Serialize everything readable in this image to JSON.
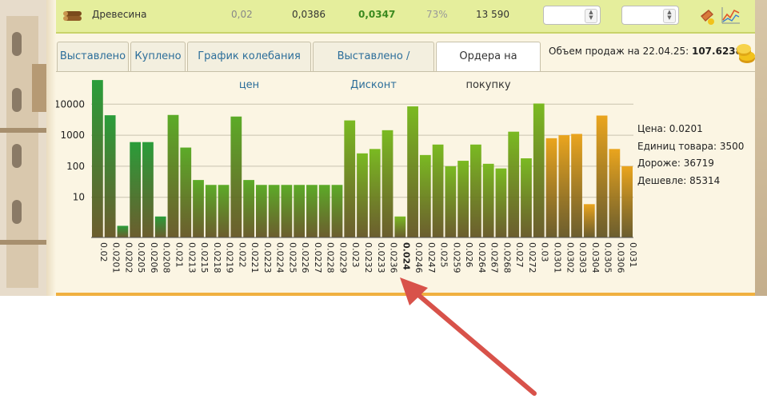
{
  "resource": {
    "icon": "wood-logs-icon",
    "name": "Древесина",
    "value1": "0,02",
    "value2": "0,0386",
    "value3": "0,0347",
    "percent": "73%",
    "quantity": "13 590",
    "input1_value": "",
    "input2_value": ""
  },
  "tabs": [
    {
      "label": "Выставлено"
    },
    {
      "label": "Куплено"
    },
    {
      "label": "График колебания цен"
    },
    {
      "label": "Выставлено / Дисконт"
    },
    {
      "label": "Ордера на покупку",
      "active": true
    }
  ],
  "sales_volume": {
    "label": "Объем продаж на 22.04.25:",
    "value": "107.6238"
  },
  "info": {
    "price": "Цена: 0.0201",
    "units": "Единиц товара: 3500",
    "higher": "Дороже: 36719",
    "lower": "Дешевле: 85314"
  },
  "chart_data": {
    "type": "bar",
    "y_scale": "log",
    "yticks": [
      "10",
      "100",
      "1000",
      "10000"
    ],
    "categories": [
      "0.02",
      "0.0201",
      "0.0202",
      "0.0205",
      "0.0206",
      "0.0208",
      "0.021",
      "0.0213",
      "0.0215",
      "0.0218",
      "0.0219",
      "0.022",
      "0.0221",
      "0.0223",
      "0.0224",
      "0.0225",
      "0.0226",
      "0.0227",
      "0.0228",
      "0.0229",
      "0.023",
      "0.0232",
      "0.0233",
      "0.0236",
      "0.024",
      "0.0246",
      "0.0247",
      "0.025",
      "0.0259",
      "0.026",
      "0.0264",
      "0.0267",
      "0.0268",
      "0.027",
      "0.0272",
      "0.03",
      "0.0301",
      "0.0302",
      "0.0303",
      "0.0304",
      "0.0305",
      "0.0306",
      "0.031"
    ],
    "values": [
      60000,
      4400,
      1.2,
      600,
      600,
      2.4,
      4500,
      400,
      36,
      25,
      25,
      4000,
      36,
      25,
      25,
      25,
      25,
      25,
      25,
      25,
      3000,
      260,
      360,
      1450,
      2.4,
      8500,
      230,
      500,
      100,
      150,
      500,
      120,
      85,
      1300,
      180,
      10500,
      800,
      1000,
      1100,
      6,
      4300,
      360,
      100
    ],
    "colors": [
      "#2a9d3a",
      "#2a9d3a",
      "#2a9d3a",
      "#2a9d3a",
      "#2a9d3a",
      "#2a9d3a",
      "#5cab28",
      "#5cab28",
      "#5cab28",
      "#5cab28",
      "#5cab28",
      "#5cab28",
      "#5cab28",
      "#5cab28",
      "#5cab28",
      "#5cab28",
      "#5cab28",
      "#5cab28",
      "#5cab28",
      "#5cab28",
      "#7aba22",
      "#7aba22",
      "#7aba22",
      "#7aba22",
      "#7aba22",
      "#7aba22",
      "#7aba22",
      "#7aba22",
      "#7aba22",
      "#7aba22",
      "#7aba22",
      "#7aba22",
      "#7aba22",
      "#7aba22",
      "#7aba22",
      "#7aba22",
      "#eaa51e",
      "#eaa51e",
      "#eaa51e",
      "#eaa51e",
      "#eaa51e",
      "#eaa51e",
      "#eaa51e"
    ],
    "highlighted_category": "0.024"
  }
}
